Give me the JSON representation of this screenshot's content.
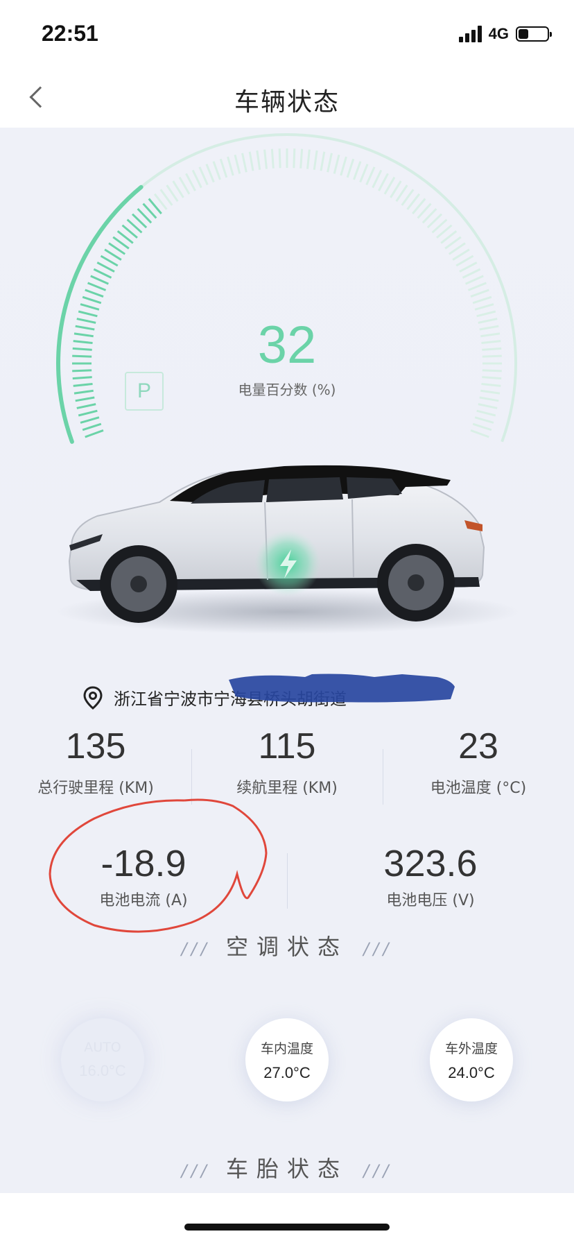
{
  "status_bar": {
    "time": "22:51",
    "network": "4G",
    "battery_level": 0.35
  },
  "nav": {
    "title": "车辆状态"
  },
  "battery": {
    "percent": "32",
    "percent_label": "电量百分数 (%)",
    "gear": "P",
    "accent_color": "#6bd3a8"
  },
  "location": {
    "text": "浙江省宁波市宁海县桥头胡街道"
  },
  "stats": [
    {
      "value": "135",
      "label": "总行驶里程 (KM)"
    },
    {
      "value": "115",
      "label": "续航里程 (KM)"
    },
    {
      "value": "23",
      "label": "电池温度 (°C)"
    }
  ],
  "stats2": [
    {
      "value": "-18.9",
      "label": "电池电流 (A)"
    },
    {
      "value": "323.6",
      "label": "电池电压 (V)"
    }
  ],
  "sections": {
    "slashes": "///",
    "ac_title": "空调状态",
    "tire_title": "车胎状态"
  },
  "ac": [
    {
      "label": "AUTO",
      "value": "16.0°C"
    },
    {
      "label": "车内温度",
      "value": "27.0°C"
    },
    {
      "label": "车外温度",
      "value": "24.0°C"
    }
  ]
}
